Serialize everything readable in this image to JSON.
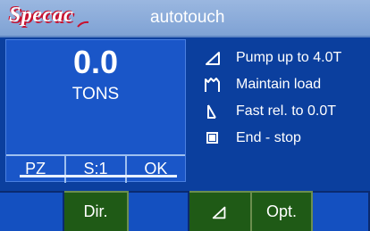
{
  "header": {
    "logo_text": "Specac",
    "title": "autotouch"
  },
  "readout": {
    "value": "0.0",
    "unit": "TONS"
  },
  "mini_buttons": [
    "PZ",
    "S:1",
    "OK"
  ],
  "legend": [
    {
      "icon": "ramp-up-icon",
      "label": "Pump up to 4.0T"
    },
    {
      "icon": "hold-icon",
      "label": "Maintain load"
    },
    {
      "icon": "release-icon",
      "label": "Fast rel. to 0.0T"
    },
    {
      "icon": "stop-square-icon",
      "label": "End - stop"
    }
  ],
  "softkeys": [
    {
      "label": "",
      "active": false
    },
    {
      "label": "Dir.",
      "active": true
    },
    {
      "label": "",
      "active": false
    },
    {
      "label": "",
      "icon": "ramp-up-icon",
      "active": true
    },
    {
      "label": "Opt.",
      "active": true
    },
    {
      "label": "",
      "active": false
    }
  ],
  "colors": {
    "background": "#0b3f9e",
    "panel": "#1a56c8",
    "title_bar": "#8eaedc",
    "softkey_active": "#1f5a16",
    "logo_accent": "#c8102e"
  }
}
